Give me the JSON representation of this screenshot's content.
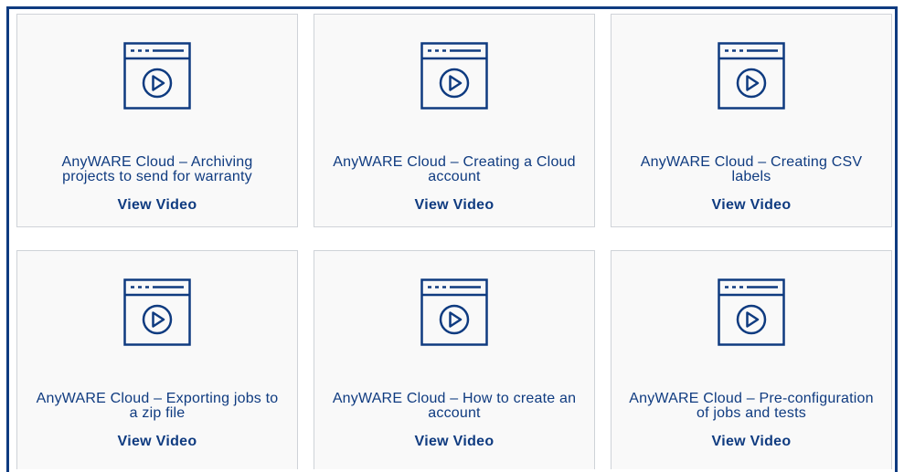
{
  "theme": {
    "accent": "#0f3b80",
    "card_bg": "#f9f9f9",
    "card_border": "#cfd3d8"
  },
  "videos": [
    {
      "title": "AnyWARE Cloud – Archiving projects to send for warranty",
      "link_label": "View Video",
      "icon": "video-player-icon"
    },
    {
      "title": "AnyWARE Cloud – Creating a Cloud account",
      "link_label": "View Video",
      "icon": "video-player-icon"
    },
    {
      "title": "AnyWARE Cloud – Creating CSV labels",
      "link_label": "View Video",
      "icon": "video-player-icon"
    },
    {
      "title": "AnyWARE Cloud – Exporting jobs to a zip file",
      "link_label": "View Video",
      "icon": "video-player-icon"
    },
    {
      "title": "AnyWARE Cloud – How to create an account",
      "link_label": "View Video",
      "icon": "video-player-icon"
    },
    {
      "title": "AnyWARE Cloud – Pre-configuration of jobs and tests",
      "link_label": "View Video",
      "icon": "video-player-icon"
    }
  ]
}
